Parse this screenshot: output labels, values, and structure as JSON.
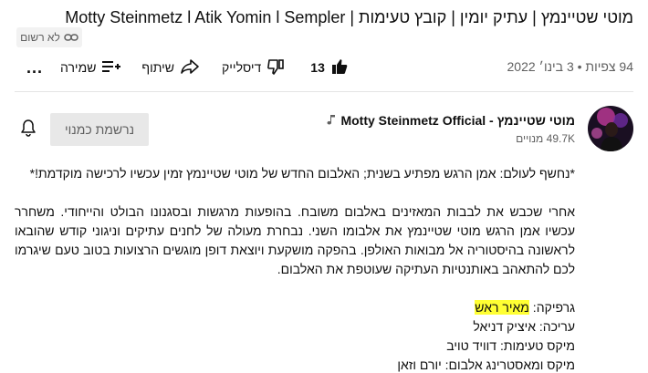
{
  "video": {
    "title": "מוטי שטיינמץ | עתיק יומין | קובץ טעימות | Motty Steinmetz l Atik Yomin l Sempler",
    "unlisted_label": "לא רשום",
    "views_date": "94 צפיות • 3 בינו׳ 2022",
    "like_count": "13",
    "dislike_label": "דיסלייק",
    "share_label": "שיתוף",
    "save_label": "שמירה",
    "more_label": "..."
  },
  "channel": {
    "name": "מוטי שטיינמץ - Motty Steinmetz Official",
    "subscribers": "49.7K מנויים",
    "subscribed_label": "נרשמת כמנוי",
    "music_icon": "music-note-icon"
  },
  "description": {
    "line1": "*נחשף לעולם: אמן הרגש מפתיע בשנית; האלבום החדש של מוטי שטיינמץ זמין עכשיו לרכישה מוקדמת!*",
    "paragraph": "אחרי שכבש את לבבות המאזינים באלבום משובח. בהופעות מרגשות ובסגנונו הבולט והייחודי. משחרר עכשיו אמן הרגש מוטי שטיינמץ את אלבומו השני. נבחרת מעולה של לחנים עתיקים וניגוני קודש שהובאו לראשונה בהיסטוריה אל מבואות האולפן. בהפקה מושקעת ויוצאת דופן מוגשים הרצועות בטוב טעם שיגרמו לכם להתאהב באותנטיות העתיקה שעוטפת את האלבום.",
    "credit_graphics_label": "גרפיקה: ",
    "credit_graphics_name": "מאיר ראש",
    "credit_editing": "עריכה: איציק דניאל",
    "credit_mix": "מיקס טעימות: דוויד טויב",
    "credit_master": "מיקס ומאסטרינג אלבום: יורם וזאן"
  },
  "colors": {
    "secondary_text": "#606060",
    "highlight": "#ffff33",
    "subscribed_bg": "#e8e8e8"
  }
}
